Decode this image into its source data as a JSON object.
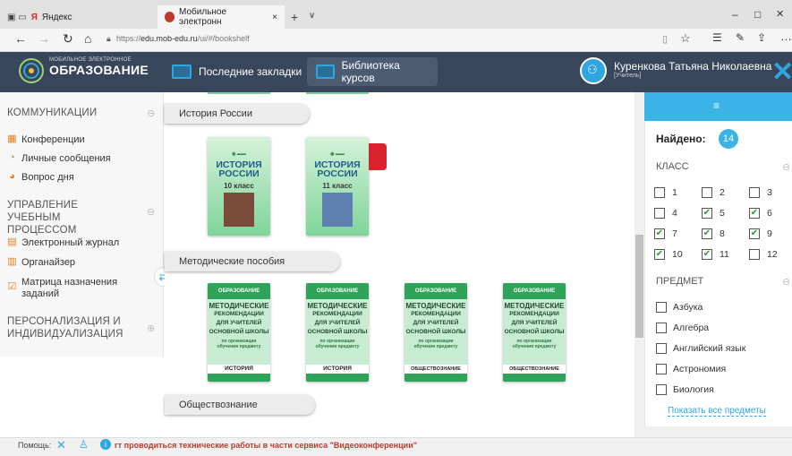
{
  "browser": {
    "tabs": [
      {
        "label": "Яндекс"
      },
      {
        "label": "Мобильное электронн"
      }
    ],
    "tab_close": "×",
    "new_tab": "+",
    "tab_menu": "∨",
    "win_min": "–",
    "win_max": "□",
    "win_close": "✕",
    "url_prefix": "https://",
    "url_host": "edu.mob-edu.ru",
    "url_path": "/ui/#/bookshelf"
  },
  "header": {
    "logo_small": "МОБИЛЬНОЕ ЭЛЕКТРОННОЕ",
    "logo_big": "ОБРАЗОВАНИЕ",
    "nav": [
      {
        "label": "Последние закладки"
      },
      {
        "label": "Библиотека курсов"
      }
    ],
    "user_name": "Куренкова Татьяна Николаевна",
    "user_role": "[Учитель]",
    "close": "✕"
  },
  "sidebar": {
    "sections": [
      {
        "label": "КОММУНИКАЦИИ",
        "toggle": "⊖",
        "items": [
          "Конференции",
          "Личные сообщения",
          "Вопрос дня"
        ]
      },
      {
        "label": "УПРАВЛЕНИЕ УЧЕБНЫМ ПРОЦЕССОМ",
        "toggle": "⊖",
        "items": [
          "Электронный журнал",
          "Органайзер",
          "Матрица назначения заданий"
        ]
      },
      {
        "label": "ПЕРСОНАЛИЗАЦИЯ И ИНДИВИДУАЛИЗАЦИЯ",
        "toggle": "⊕",
        "items": []
      }
    ]
  },
  "main": {
    "shelves": [
      {
        "title": "История России",
        "books": [
          {
            "title": "ИСТОРИЯ РОССИИ",
            "grade": "10 класс"
          },
          {
            "title": "ИСТОРИЯ РОССИИ",
            "grade": "11 класс"
          }
        ]
      },
      {
        "title": "Методические пособия",
        "books": [
          {
            "brand": "ОБРАЗОВАНИЕ",
            "title": "МЕТОДИЧЕСКИЕ",
            "sub": "РЕКОМЕНДАЦИИ",
            "sub2": "ДЛЯ УЧИТЕЛЕЙ",
            "sub3": "ОСНОВНОЙ ШКОЛЫ",
            "note": "по организации обучения предмету",
            "subject": "ИСТОРИЯ"
          },
          {
            "brand": "ОБРАЗОВАНИЕ",
            "title": "МЕТОДИЧЕСКИЕ",
            "sub": "РЕКОМЕНДАЦИИ",
            "sub2": "ДЛЯ УЧИТЕЛЕЙ",
            "sub3": "ОСНОВНОЙ ШКОЛЫ",
            "note": "по организации обучения предмету",
            "subject": "ИСТОРИЯ"
          },
          {
            "brand": "ОБРАЗОВАНИЕ",
            "title": "МЕТОДИЧЕСКИЕ",
            "sub": "РЕКОМЕНДАЦИИ",
            "sub2": "ДЛЯ УЧИТЕЛЕЙ",
            "sub3": "ОСНОВНОЙ ШКОЛЫ",
            "note": "по организации обучения предмету",
            "subject": "ОБЩЕСТВОЗНАНИЕ"
          },
          {
            "brand": "ОБРАЗОВАНИЕ",
            "title": "МЕТОДИЧЕСКИЕ",
            "sub": "РЕКОМЕНДАЦИИ",
            "sub2": "ДЛЯ УЧИТЕЛЕЙ",
            "sub3": "ОСНОВНОЙ ШКОЛЫ",
            "note": "по организации обучения предмету",
            "subject": "ОБЩЕСТВОЗНАНИЕ"
          }
        ]
      },
      {
        "title": "Обществознание",
        "books": []
      }
    ]
  },
  "filters": {
    "found_label": "Найдено:",
    "found_count": "14",
    "class_label": "КЛАСС",
    "classes": [
      {
        "label": "1",
        "checked": false
      },
      {
        "label": "2",
        "checked": false
      },
      {
        "label": "3",
        "checked": false
      },
      {
        "label": "4",
        "checked": false
      },
      {
        "label": "5",
        "checked": true
      },
      {
        "label": "6",
        "checked": true
      },
      {
        "label": "7",
        "checked": true
      },
      {
        "label": "8",
        "checked": true
      },
      {
        "label": "9",
        "checked": true
      },
      {
        "label": "10",
        "checked": true
      },
      {
        "label": "11",
        "checked": true
      },
      {
        "label": "12",
        "checked": false
      }
    ],
    "subject_label": "ПРЕДМЕТ",
    "subjects": [
      {
        "label": "Азбука"
      },
      {
        "label": "Алгебра"
      },
      {
        "label": "Английский язык"
      },
      {
        "label": "Астрономия"
      },
      {
        "label": "Биология"
      }
    ],
    "show_all": "Показать все предметы"
  },
  "status": {
    "help": "Помощь:",
    "message": "гт проводиться технические работы в части сервиса \"Видеоконференции\""
  },
  "colors": {
    "accent": "#2ea7e0",
    "header": "#37465a",
    "book_green": "#2fa35a"
  }
}
